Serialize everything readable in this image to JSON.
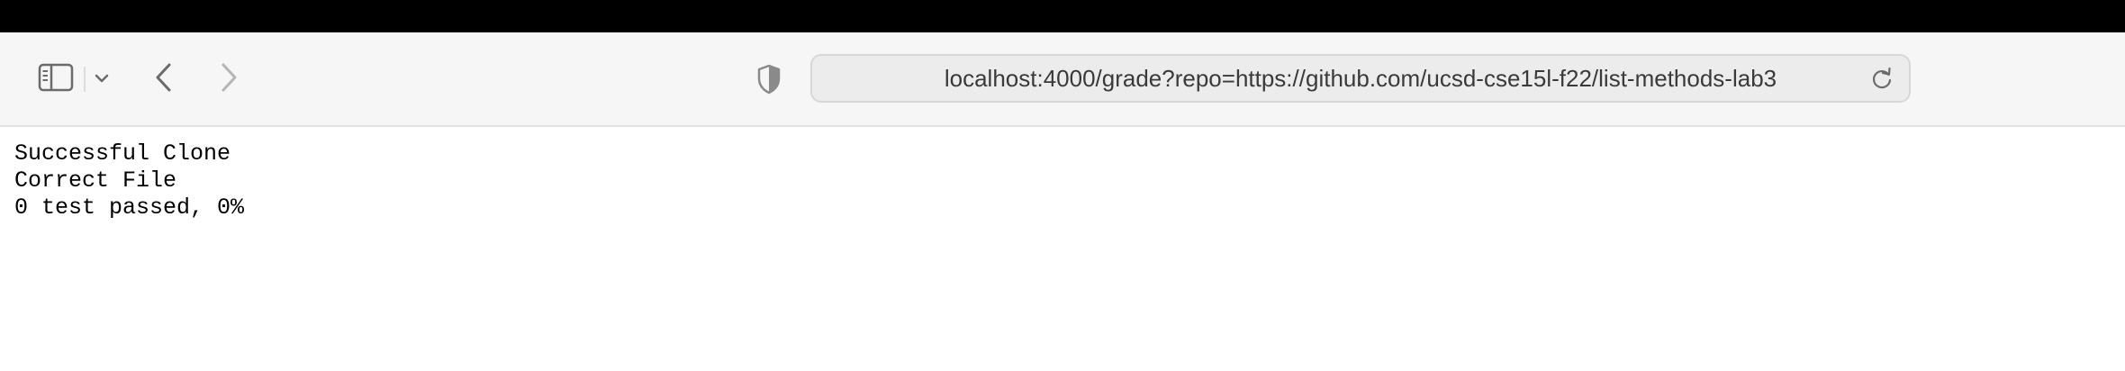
{
  "browser": {
    "url": "localhost:4000/grade?repo=https://github.com/ucsd-cse15l-f22/list-methods-lab3",
    "icons": {
      "sidebar": "sidebar-icon",
      "chevron": "chevron-down-icon",
      "back": "back-arrow-icon",
      "forward": "forward-arrow-icon",
      "privacy": "shield-icon",
      "reload": "reload-icon"
    },
    "colors": {
      "toolbar_bg": "#f6f6f6",
      "address_bg": "#ececec",
      "menubar_bg": "#000000"
    }
  },
  "page": {
    "lines": [
      "Successful Clone",
      "Correct File",
      "0 test passed, 0%"
    ]
  }
}
